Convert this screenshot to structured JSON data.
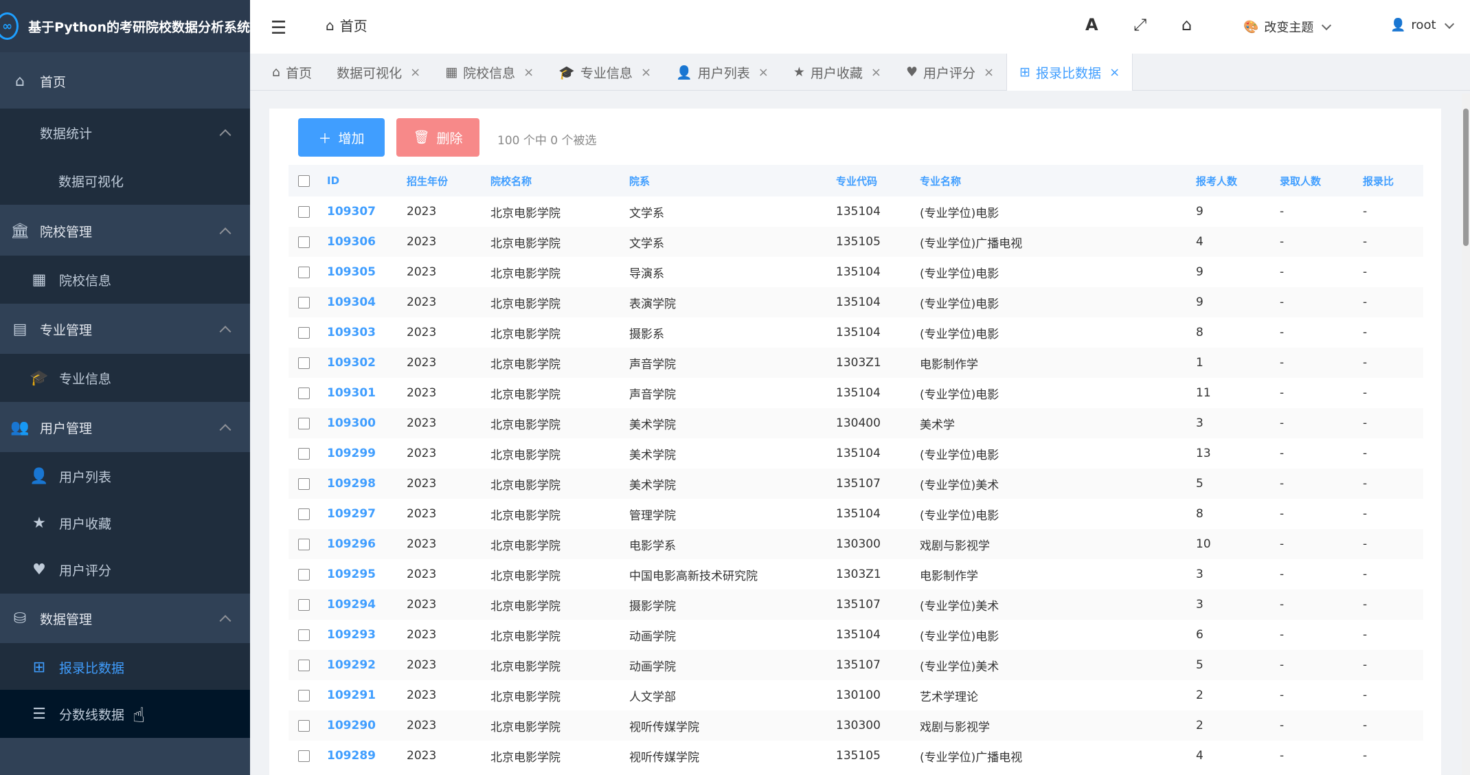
{
  "app": {
    "title": "基于Python的考研院校数据分析系统"
  },
  "sidebar": {
    "items": [
      {
        "label": "首页",
        "icon": "home-icon",
        "level": "top"
      },
      {
        "label": "数据统计",
        "level": "group"
      },
      {
        "label": "数据可视化",
        "level": "sub"
      },
      {
        "label": "院校管理",
        "icon": "bank-icon",
        "level": "top"
      },
      {
        "label": "院校信息",
        "icon": "building-icon",
        "level": "sub"
      },
      {
        "label": "专业管理",
        "icon": "book-icon",
        "level": "top"
      },
      {
        "label": "专业信息",
        "icon": "graduation-cap-icon",
        "level": "sub"
      },
      {
        "label": "用户管理",
        "icon": "users-icon",
        "level": "top"
      },
      {
        "label": "用户列表",
        "icon": "user-icon",
        "level": "sub"
      },
      {
        "label": "用户收藏",
        "icon": "star-icon",
        "level": "sub"
      },
      {
        "label": "用户评分",
        "icon": "heart-icon",
        "level": "sub"
      },
      {
        "label": "数据管理",
        "icon": "database-icon",
        "level": "top"
      },
      {
        "label": "报录比数据",
        "icon": "table-icon",
        "level": "sub",
        "active": true
      },
      {
        "label": "分数线数据",
        "icon": "list-icon",
        "level": "sub"
      }
    ]
  },
  "header": {
    "breadcrumb": "首页",
    "theme_label": "改变主题",
    "user": "root"
  },
  "tabs": [
    {
      "label": "首页",
      "icon": "home-icon",
      "closable": false
    },
    {
      "label": "数据可视化",
      "closable": true
    },
    {
      "label": "院校信息",
      "icon": "building-icon",
      "closable": true
    },
    {
      "label": "专业信息",
      "icon": "graduation-cap-icon",
      "closable": true
    },
    {
      "label": "用户列表",
      "icon": "user-icon",
      "closable": true
    },
    {
      "label": "用户收藏",
      "icon": "star-icon",
      "closable": true
    },
    {
      "label": "用户评分",
      "icon": "heart-icon",
      "closable": true
    },
    {
      "label": "报录比数据",
      "icon": "table-icon",
      "closable": true,
      "active": true
    }
  ],
  "toolbar": {
    "add_label": "增加",
    "delete_label": "删除",
    "selection_info": "100 个中 0 个被选"
  },
  "table": {
    "columns": [
      "ID",
      "招生年份",
      "院校名称",
      "院系",
      "专业代码",
      "专业名称",
      "报考人数",
      "录取人数",
      "报录比"
    ],
    "rows": [
      [
        "109307",
        "2023",
        "北京电影学院",
        "文学系",
        "135104",
        "(专业学位)电影",
        "9",
        "-",
        "-"
      ],
      [
        "109306",
        "2023",
        "北京电影学院",
        "文学系",
        "135105",
        "(专业学位)广播电视",
        "4",
        "-",
        "-"
      ],
      [
        "109305",
        "2023",
        "北京电影学院",
        "导演系",
        "135104",
        "(专业学位)电影",
        "9",
        "-",
        "-"
      ],
      [
        "109304",
        "2023",
        "北京电影学院",
        "表演学院",
        "135104",
        "(专业学位)电影",
        "9",
        "-",
        "-"
      ],
      [
        "109303",
        "2023",
        "北京电影学院",
        "摄影系",
        "135104",
        "(专业学位)电影",
        "8",
        "-",
        "-"
      ],
      [
        "109302",
        "2023",
        "北京电影学院",
        "声音学院",
        "1303Z1",
        "电影制作学",
        "1",
        "-",
        "-"
      ],
      [
        "109301",
        "2023",
        "北京电影学院",
        "声音学院",
        "135104",
        "(专业学位)电影",
        "11",
        "-",
        "-"
      ],
      [
        "109300",
        "2023",
        "北京电影学院",
        "美术学院",
        "130400",
        "美术学",
        "3",
        "-",
        "-"
      ],
      [
        "109299",
        "2023",
        "北京电影学院",
        "美术学院",
        "135104",
        "(专业学位)电影",
        "13",
        "-",
        "-"
      ],
      [
        "109298",
        "2023",
        "北京电影学院",
        "美术学院",
        "135107",
        "(专业学位)美术",
        "5",
        "-",
        "-"
      ],
      [
        "109297",
        "2023",
        "北京电影学院",
        "管理学院",
        "135104",
        "(专业学位)电影",
        "8",
        "-",
        "-"
      ],
      [
        "109296",
        "2023",
        "北京电影学院",
        "电影学系",
        "130300",
        "戏剧与影视学",
        "10",
        "-",
        "-"
      ],
      [
        "109295",
        "2023",
        "北京电影学院",
        "中国电影高新技术研究院",
        "1303Z1",
        "电影制作学",
        "3",
        "-",
        "-"
      ],
      [
        "109294",
        "2023",
        "北京电影学院",
        "摄影学院",
        "135107",
        "(专业学位)美术",
        "3",
        "-",
        "-"
      ],
      [
        "109293",
        "2023",
        "北京电影学院",
        "动画学院",
        "135104",
        "(专业学位)电影",
        "6",
        "-",
        "-"
      ],
      [
        "109292",
        "2023",
        "北京电影学院",
        "动画学院",
        "135107",
        "(专业学位)美术",
        "5",
        "-",
        "-"
      ],
      [
        "109291",
        "2023",
        "北京电影学院",
        "人文学部",
        "130100",
        "艺术学理论",
        "2",
        "-",
        "-"
      ],
      [
        "109290",
        "2023",
        "北京电影学院",
        "视听传媒学院",
        "130300",
        "戏剧与影视学",
        "2",
        "-",
        "-"
      ],
      [
        "109289",
        "2023",
        "北京电影学院",
        "视听传媒学院",
        "135105",
        "(专业学位)广播电视",
        "4",
        "-",
        "-"
      ]
    ]
  }
}
